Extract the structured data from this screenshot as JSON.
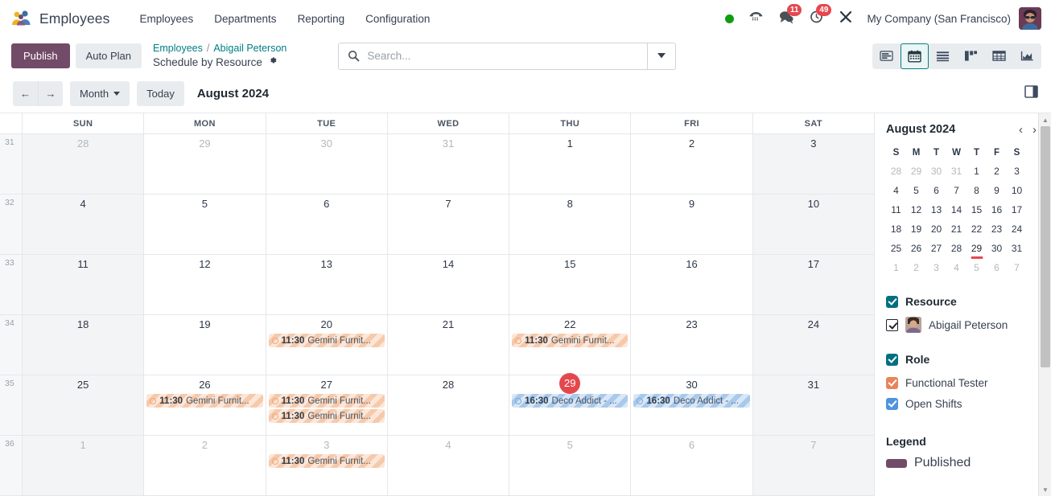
{
  "navbar": {
    "brand": "Employees",
    "menu": [
      "Employees",
      "Departments",
      "Reporting",
      "Configuration"
    ],
    "status_dot": "online-dot",
    "icons": [
      "phone-icon",
      "messages-icon",
      "activities-icon",
      "developer-tools-icon"
    ],
    "messages_count": "11",
    "activities_count": "49",
    "company": "My Company (San Francisco)",
    "avatar": "user-avatar"
  },
  "control": {
    "publish_label": "Publish",
    "auto_plan_label": "Auto Plan",
    "breadcrumb": {
      "root": "Employees",
      "separator": "/",
      "current": "Abigail Peterson"
    },
    "view_title": "Schedule by Resource",
    "search_placeholder": "Search...",
    "search_value": "",
    "views": [
      {
        "name": "gantt-view",
        "active": false
      },
      {
        "name": "calendar-view",
        "active": true
      },
      {
        "name": "list-view",
        "active": false
      },
      {
        "name": "kanban-view",
        "active": false
      },
      {
        "name": "pivot-view",
        "active": false
      },
      {
        "name": "graph-view",
        "active": false
      }
    ]
  },
  "toolbar": {
    "prev": "←",
    "next": "→",
    "scale": "Month",
    "today": "Today",
    "period_title": "August 2024"
  },
  "calendar": {
    "day_headers": [
      "SUN",
      "MON",
      "TUE",
      "WED",
      "THU",
      "FRI",
      "SAT"
    ],
    "weeks": [
      {
        "week_number": "31",
        "days": [
          {
            "num": "28",
            "other_month": true,
            "weekend": true,
            "today": false,
            "events": []
          },
          {
            "num": "29",
            "other_month": true,
            "weekend": false,
            "today": false,
            "events": []
          },
          {
            "num": "30",
            "other_month": true,
            "weekend": false,
            "today": false,
            "events": []
          },
          {
            "num": "31",
            "other_month": true,
            "weekend": false,
            "today": false,
            "events": []
          },
          {
            "num": "1",
            "other_month": false,
            "weekend": false,
            "today": false,
            "events": []
          },
          {
            "num": "2",
            "other_month": false,
            "weekend": false,
            "today": false,
            "events": []
          },
          {
            "num": "3",
            "other_month": false,
            "weekend": true,
            "today": false,
            "events": []
          }
        ]
      },
      {
        "week_number": "32",
        "days": [
          {
            "num": "4",
            "other_month": false,
            "weekend": true,
            "today": false,
            "events": []
          },
          {
            "num": "5",
            "other_month": false,
            "weekend": false,
            "today": false,
            "events": []
          },
          {
            "num": "6",
            "other_month": false,
            "weekend": false,
            "today": false,
            "events": []
          },
          {
            "num": "7",
            "other_month": false,
            "weekend": false,
            "today": false,
            "events": []
          },
          {
            "num": "8",
            "other_month": false,
            "weekend": false,
            "today": false,
            "events": []
          },
          {
            "num": "9",
            "other_month": false,
            "weekend": false,
            "today": false,
            "events": []
          },
          {
            "num": "10",
            "other_month": false,
            "weekend": true,
            "today": false,
            "events": []
          }
        ]
      },
      {
        "week_number": "33",
        "days": [
          {
            "num": "11",
            "other_month": false,
            "weekend": true,
            "today": false,
            "events": []
          },
          {
            "num": "12",
            "other_month": false,
            "weekend": false,
            "today": false,
            "events": []
          },
          {
            "num": "13",
            "other_month": false,
            "weekend": false,
            "today": false,
            "events": []
          },
          {
            "num": "14",
            "other_month": false,
            "weekend": false,
            "today": false,
            "events": []
          },
          {
            "num": "15",
            "other_month": false,
            "weekend": false,
            "today": false,
            "events": []
          },
          {
            "num": "16",
            "other_month": false,
            "weekend": false,
            "today": false,
            "events": []
          },
          {
            "num": "17",
            "other_month": false,
            "weekend": true,
            "today": false,
            "events": []
          }
        ]
      },
      {
        "week_number": "34",
        "days": [
          {
            "num": "18",
            "other_month": false,
            "weekend": true,
            "today": false,
            "events": []
          },
          {
            "num": "19",
            "other_month": false,
            "weekend": false,
            "today": false,
            "events": []
          },
          {
            "num": "20",
            "other_month": false,
            "weekend": false,
            "today": false,
            "events": [
              {
                "time": "11:30",
                "title": "Gemini Furnit...",
                "color": "orange"
              }
            ]
          },
          {
            "num": "21",
            "other_month": false,
            "weekend": false,
            "today": false,
            "events": []
          },
          {
            "num": "22",
            "other_month": false,
            "weekend": false,
            "today": false,
            "events": [
              {
                "time": "11:30",
                "title": "Gemini Furnit...",
                "color": "orange"
              }
            ]
          },
          {
            "num": "23",
            "other_month": false,
            "weekend": false,
            "today": false,
            "events": []
          },
          {
            "num": "24",
            "other_month": false,
            "weekend": true,
            "today": false,
            "events": []
          }
        ]
      },
      {
        "week_number": "35",
        "days": [
          {
            "num": "25",
            "other_month": false,
            "weekend": true,
            "today": false,
            "events": []
          },
          {
            "num": "26",
            "other_month": false,
            "weekend": false,
            "today": false,
            "events": [
              {
                "time": "11:30",
                "title": "Gemini Furnit...",
                "color": "orange"
              }
            ]
          },
          {
            "num": "27",
            "other_month": false,
            "weekend": false,
            "today": false,
            "events": [
              {
                "time": "11:30",
                "title": "Gemini Furnit...",
                "color": "orange"
              },
              {
                "time": "11:30",
                "title": "Gemini Furnit...",
                "color": "orange"
              }
            ]
          },
          {
            "num": "28",
            "other_month": false,
            "weekend": false,
            "today": false,
            "events": []
          },
          {
            "num": "29",
            "other_month": false,
            "weekend": false,
            "today": true,
            "events": [
              {
                "time": "16:30",
                "title": "Deco Addict - ...",
                "color": "blue"
              }
            ]
          },
          {
            "num": "30",
            "other_month": false,
            "weekend": false,
            "today": false,
            "events": [
              {
                "time": "16:30",
                "title": "Deco Addict - ...",
                "color": "blue"
              }
            ]
          },
          {
            "num": "31",
            "other_month": false,
            "weekend": true,
            "today": false,
            "events": []
          }
        ]
      },
      {
        "week_number": "36",
        "days": [
          {
            "num": "1",
            "other_month": true,
            "weekend": true,
            "today": false,
            "events": []
          },
          {
            "num": "2",
            "other_month": true,
            "weekend": false,
            "today": false,
            "events": []
          },
          {
            "num": "3",
            "other_month": true,
            "weekend": false,
            "today": false,
            "events": [
              {
                "time": "11:30",
                "title": "Gemini Furnit...",
                "color": "orange"
              }
            ]
          },
          {
            "num": "4",
            "other_month": true,
            "weekend": false,
            "today": false,
            "events": []
          },
          {
            "num": "5",
            "other_month": true,
            "weekend": false,
            "today": false,
            "events": []
          },
          {
            "num": "6",
            "other_month": true,
            "weekend": false,
            "today": false,
            "events": []
          },
          {
            "num": "7",
            "other_month": true,
            "weekend": true,
            "today": false,
            "events": []
          }
        ]
      }
    ]
  },
  "sidebar": {
    "mini_calendar": {
      "title": "August 2024",
      "dow": [
        "S",
        "M",
        "T",
        "W",
        "T",
        "F",
        "S"
      ],
      "days": [
        {
          "n": "28",
          "muted": true
        },
        {
          "n": "29",
          "muted": true
        },
        {
          "n": "30",
          "muted": true
        },
        {
          "n": "31",
          "muted": true
        },
        {
          "n": "1",
          "muted": false
        },
        {
          "n": "2",
          "muted": false
        },
        {
          "n": "3",
          "muted": false
        },
        {
          "n": "4",
          "muted": false
        },
        {
          "n": "5",
          "muted": false
        },
        {
          "n": "6",
          "muted": false
        },
        {
          "n": "7",
          "muted": false
        },
        {
          "n": "8",
          "muted": false
        },
        {
          "n": "9",
          "muted": false
        },
        {
          "n": "10",
          "muted": false
        },
        {
          "n": "11",
          "muted": false
        },
        {
          "n": "12",
          "muted": false
        },
        {
          "n": "13",
          "muted": false
        },
        {
          "n": "14",
          "muted": false
        },
        {
          "n": "15",
          "muted": false
        },
        {
          "n": "16",
          "muted": false
        },
        {
          "n": "17",
          "muted": false
        },
        {
          "n": "18",
          "muted": false
        },
        {
          "n": "19",
          "muted": false
        },
        {
          "n": "20",
          "muted": false
        },
        {
          "n": "21",
          "muted": false
        },
        {
          "n": "22",
          "muted": false
        },
        {
          "n": "23",
          "muted": false
        },
        {
          "n": "24",
          "muted": false
        },
        {
          "n": "25",
          "muted": false
        },
        {
          "n": "26",
          "muted": false
        },
        {
          "n": "27",
          "muted": false
        },
        {
          "n": "28",
          "muted": false
        },
        {
          "n": "29",
          "muted": false,
          "selected": true
        },
        {
          "n": "30",
          "muted": false
        },
        {
          "n": "31",
          "muted": false
        },
        {
          "n": "1",
          "muted": true
        },
        {
          "n": "2",
          "muted": true
        },
        {
          "n": "3",
          "muted": true
        },
        {
          "n": "4",
          "muted": true
        },
        {
          "n": "5",
          "muted": true
        },
        {
          "n": "6",
          "muted": true
        },
        {
          "n": "7",
          "muted": true
        }
      ]
    },
    "filters": [
      {
        "title": "Resource",
        "color": "#00707f",
        "checked": true,
        "rows": [
          {
            "label": "Abigail Peterson",
            "style": "white",
            "checked": true,
            "avatar": true
          }
        ]
      },
      {
        "title": "Role",
        "color": "#00707f",
        "checked": true,
        "rows": [
          {
            "label": "Functional Tester",
            "style": "orange",
            "checked": true,
            "avatar": false
          },
          {
            "label": "Open Shifts",
            "style": "blue",
            "checked": true,
            "avatar": false
          }
        ]
      }
    ],
    "legend": {
      "title": "Legend",
      "items": [
        {
          "label": "Published",
          "color": "#714b67"
        }
      ]
    }
  },
  "colors": {
    "brand_purple": "#714b67",
    "link_teal": "#017e84",
    "today_red": "#e4484e",
    "event_orange": "#f6c9ab",
    "event_blue": "#a8c9ec"
  }
}
